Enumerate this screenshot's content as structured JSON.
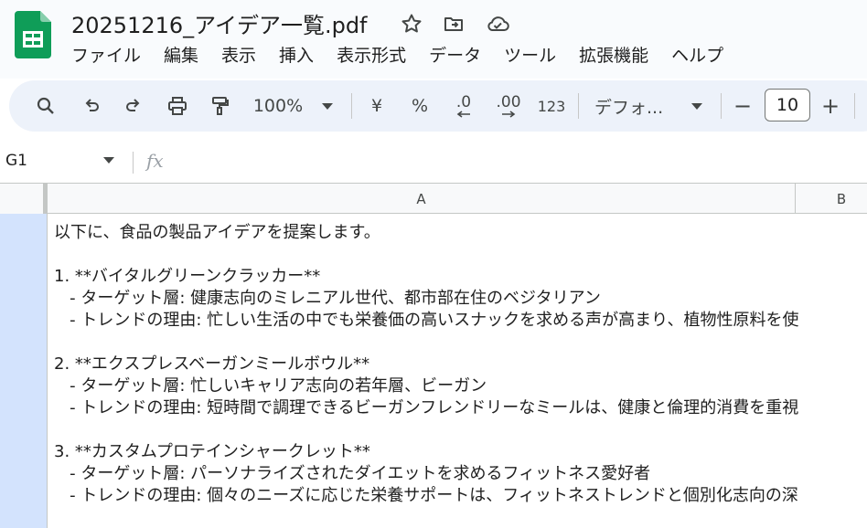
{
  "doc": {
    "title": "20251216_アイデア一覧.pdf"
  },
  "title_icons": [
    "star-icon",
    "move-to-folder-icon",
    "cloud-saved-icon"
  ],
  "menu": [
    "ファイル",
    "編集",
    "表示",
    "挿入",
    "表示形式",
    "データ",
    "ツール",
    "拡張機能",
    "ヘルプ"
  ],
  "toolbar": {
    "zoom": "100%",
    "currency": "¥",
    "percent": "%",
    "decrease_decimal": ".0",
    "increase_decimal": ".00",
    "number_format": "123",
    "font": "デフォ...",
    "font_size": "10",
    "minus": "−",
    "plus": "+"
  },
  "formula_bar": {
    "cell_ref": "G1",
    "fx": "fx"
  },
  "columns": [
    "A",
    "B"
  ],
  "cell": {
    "lines": [
      "以下に、食品の製品アイデアを提案します。",
      "",
      "1. **バイタルグリーンクラッカー**",
      "   - ターゲット層: 健康志向のミレニアル世代、都市部在住のベジタリアン",
      "   - トレンドの理由: 忙しい生活の中でも栄養価の高いスナックを求める声が高まり、植物性原料を使",
      "",
      "2. **エクスプレスベーガンミールボウル**",
      "   - ターゲット層: 忙しいキャリア志向の若年層、ビーガン",
      "   - トレンドの理由: 短時間で調理できるビーガンフレンドリーなミールは、健康と倫理的消費を重視",
      "",
      "3. **カスタムプロテインシャークレット**",
      "   - ターゲット層: パーソナライズされたダイエットを求めるフィットネス愛好者",
      "   - トレンドの理由: 個々のニーズに応じた栄養サポートは、フィットネストレンドと個別化志向の深"
    ]
  },
  "colors": {
    "toolbar_bg": "#edf2fa",
    "sheets_green": "#0f9d58",
    "selected_row_header": "#d3e3fd"
  }
}
